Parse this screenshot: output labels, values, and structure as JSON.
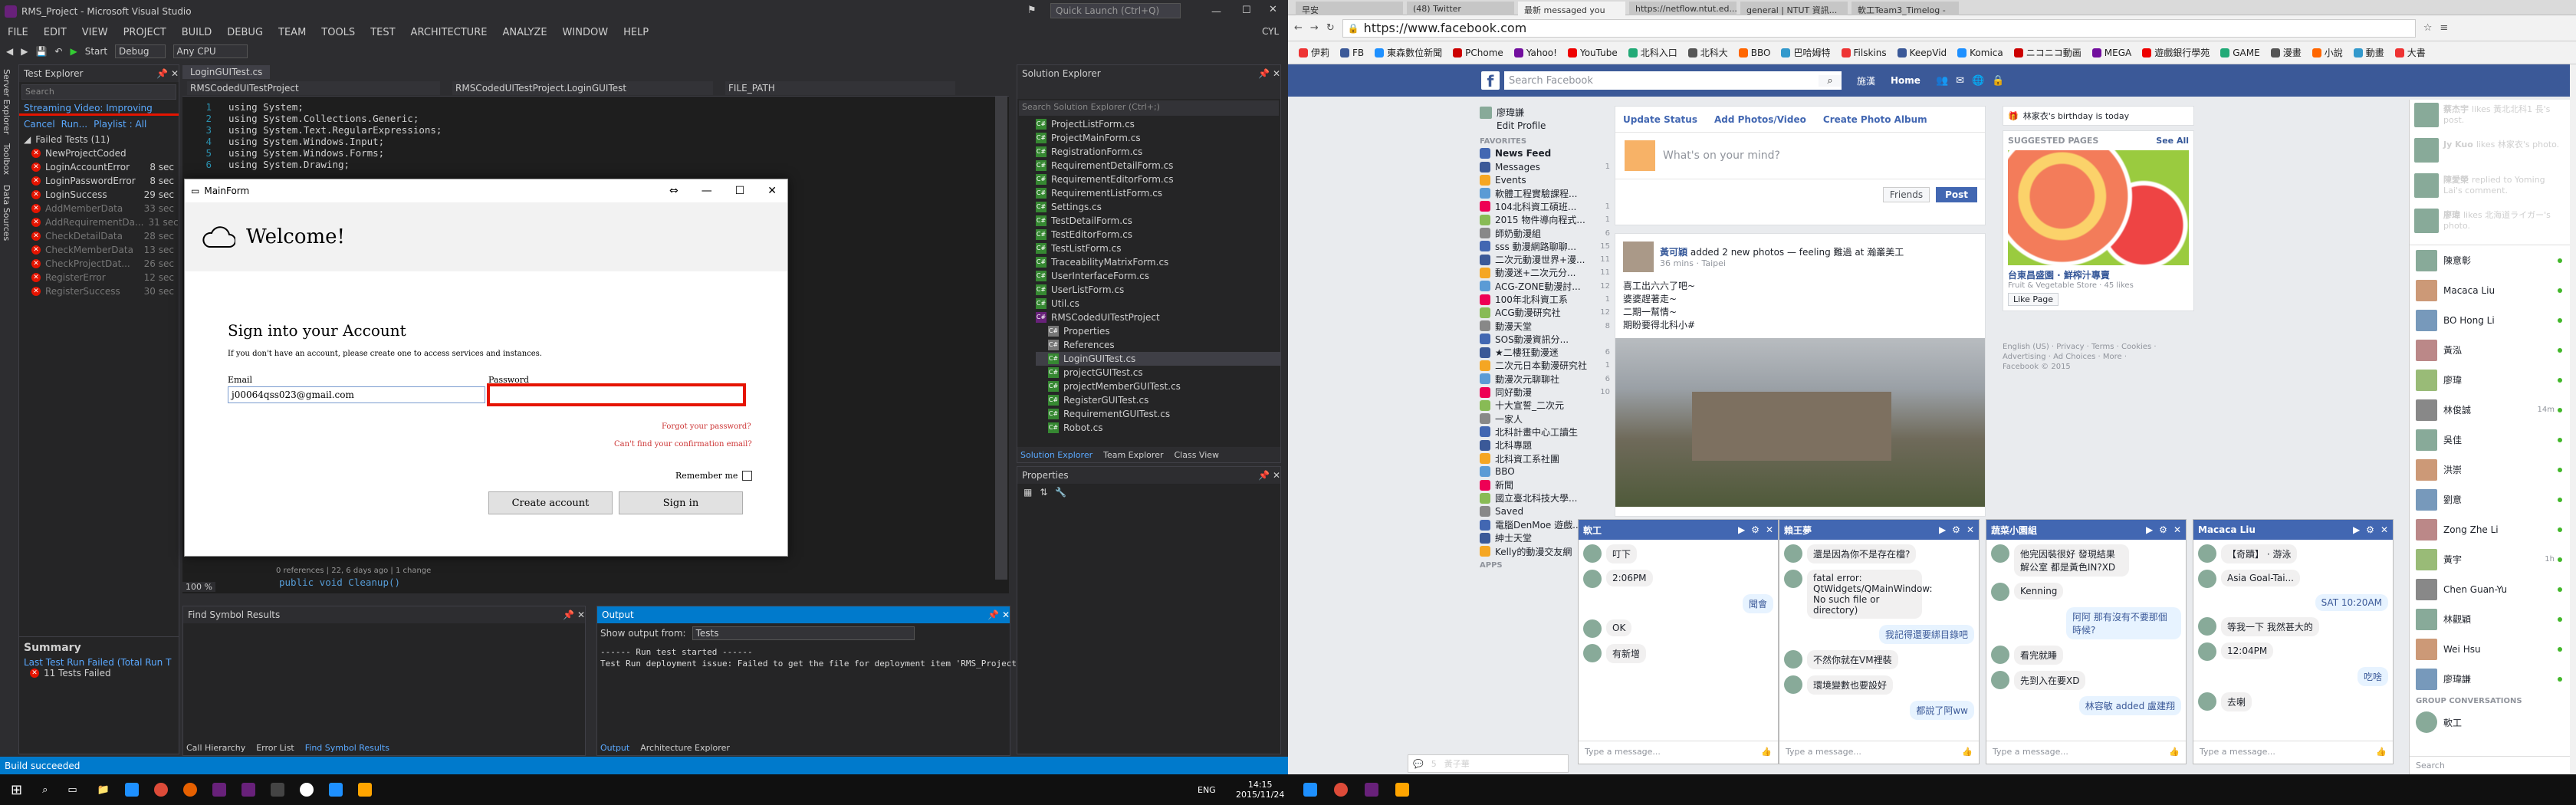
{
  "vs": {
    "window_title": "RMS_Project - Microsoft Visual Studio",
    "quick_launch_placeholder": "Quick Launch (Ctrl+Q)",
    "user": "CYL",
    "menu": [
      "FILE",
      "EDIT",
      "VIEW",
      "PROJECT",
      "BUILD",
      "DEBUG",
      "TEAM",
      "TOOLS",
      "TEST",
      "ARCHITECTURE",
      "ANALYZE",
      "WINDOW",
      "HELP"
    ],
    "toolbar": {
      "start": "Start",
      "config": "Debug",
      "platform": "Any CPU"
    },
    "test_explorer": {
      "title": "Test Explorer",
      "search_placeholder": "Search",
      "streaming": "Streaming Video: Improving",
      "actions": [
        "Cancel",
        "Run...",
        "Playlist : All"
      ],
      "failed_header": "Failed Tests (11)",
      "tests": [
        {
          "name": "NewProjectCoded",
          "time": ""
        },
        {
          "name": "LoginAccountError",
          "time": "8 sec"
        },
        {
          "name": "LoginPasswordError",
          "time": "8 sec"
        },
        {
          "name": "LoginSuccess",
          "time": "29 sec"
        },
        {
          "name": "AddMemberData",
          "time": "33 sec"
        },
        {
          "name": "AddRequirementDa...",
          "time": "31 sec"
        },
        {
          "name": "CheckDetailData",
          "time": "28 sec"
        },
        {
          "name": "CheckMemberData",
          "time": "13 sec"
        },
        {
          "name": "CheckProjectDat...",
          "time": "26 sec"
        },
        {
          "name": "RegisterError",
          "time": "12 sec"
        },
        {
          "name": "RegisterSuccess",
          "time": "30 sec"
        }
      ],
      "summary_title": "Summary",
      "summary_last": "Last Test Run Failed (Total Run T",
      "summary_failed": "11 Tests Failed"
    },
    "side_tabs": [
      "Server Explorer",
      "Toolbox",
      "Data Sources"
    ],
    "editor": {
      "tab": "LoginGUITest.cs",
      "nav_left": "RMSCodedUITestProject",
      "nav_mid": "RMSCodedUITestProject.LoginGUITest",
      "nav_right": "FILE_PATH",
      "lines": [
        "using System;",
        "using System.Collections.Generic;",
        "using System.Text.RegularExpressions;",
        "using System.Windows.Input;",
        "using System.Windows.Forms;",
        "using System.Drawing;"
      ],
      "bottom_hint": "0 references | 22, 6 days ago | 1 change",
      "bottom_code": "public void Cleanup()",
      "zoom": "100 %"
    },
    "find_symbol": {
      "title": "Find Symbol Results",
      "tabs": [
        "Call Hierarchy",
        "Error List",
        "Find Symbol Results"
      ]
    },
    "output": {
      "title": "Output",
      "show_from_label": "Show output from:",
      "show_from_value": "Tests",
      "lines": [
        "------ Run test started ------",
        "Test Run deployment issue: Failed to get the file for deployment item 'RMS_Project.ex"
      ],
      "tabs": [
        "Output",
        "Architecture Explorer"
      ]
    },
    "solution_explorer": {
      "title": "Solution Explorer",
      "search_placeholder": "Search Solution Explorer (Ctrl+;)",
      "items": [
        "ProjectListForm.cs",
        "ProjectMainForm.cs",
        "RegistrationForm.cs",
        "RequirementDetailForm.cs",
        "RequirementEditorForm.cs",
        "RequirementListForm.cs",
        "Settings.cs",
        "TestDetailForm.cs",
        "TestEditorForm.cs",
        "TestListForm.cs",
        "TraceabilityMatrixForm.cs",
        "UserInterfaceForm.cs",
        "UserListForm.cs",
        "Util.cs",
        "RMSCodedUITestProject",
        "Properties",
        "References",
        "LoginGUITest.cs",
        "projectGUITest.cs",
        "projectMemberGUITest.cs",
        "RegisterGUITest.cs",
        "RequirementGUITest.cs",
        "Robot.cs"
      ],
      "tabs": [
        "Solution Explorer",
        "Team Explorer",
        "Class View"
      ]
    },
    "properties": {
      "title": "Properties"
    },
    "status": "Build succeeded"
  },
  "mainform": {
    "title": "MainForm",
    "welcome": "Welcome!",
    "heading": "Sign into your Account",
    "subtext": "If you don't have an account, please create one to access services and instances.",
    "email_label": "Email",
    "email_value": "j00064qss023@gmail.com",
    "password_label": "Password",
    "forgot": "Forgot your password?",
    "cant_find": "Can't find your confirmation email?",
    "remember": "Remember me",
    "create_btn": "Create account",
    "signin_btn": "Sign in"
  },
  "browser": {
    "tabs": [
      "早安",
      "(48) Twitter",
      "最新 messaged you",
      "https://netflow.ntut.ed...",
      "general | NTUT 資訊...",
      "軟工Team3_Timelog -"
    ],
    "url": "https://www.facebook.com",
    "bookmarks": [
      "伊莉",
      "FB",
      "東森數位新聞",
      "PChome",
      "Yahoo!",
      "YouTube",
      "北科入口",
      "北科大",
      "BBO",
      "巴哈姆特",
      "Filskins",
      "KeepVid",
      "Komica",
      "ニコニコ動画",
      "MEGA",
      "遊戲銀行學苑",
      "GAME",
      "漫畫",
      "小說",
      "動畫",
      "大書"
    ],
    "fb": {
      "search_placeholder": "Search Facebook",
      "user": "施漢",
      "home": "Home",
      "left_top": [
        "廖瑋謙",
        "Edit Profile"
      ],
      "favorites_label": "FAVORITES",
      "left_items": [
        {
          "label": "News Feed",
          "count": ""
        },
        {
          "label": "Messages",
          "count": "1"
        },
        {
          "label": "Events",
          "count": ""
        },
        {
          "label": "軟體工程實驗課程...",
          "count": ""
        },
        {
          "label": "104北科資工碩班...",
          "count": "1"
        },
        {
          "label": "2015 物件導向程式...",
          "count": "1"
        },
        {
          "label": "師奶動漫組",
          "count": "6"
        },
        {
          "label": "sss 動漫網路聊聊...",
          "count": "15"
        },
        {
          "label": "二次元動漫世界+漫...",
          "count": "11"
        },
        {
          "label": "動漫迷+二次元分...",
          "count": "11"
        },
        {
          "label": "ACG-ZONE動漫討...",
          "count": "12"
        },
        {
          "label": "100年北科資工系",
          "count": "1"
        },
        {
          "label": "ACG動漫研究社",
          "count": "12"
        },
        {
          "label": "動漫天堂",
          "count": "8"
        },
        {
          "label": "SOS動漫資訊分...",
          "count": ""
        },
        {
          "label": "★二樓狂動漫迷",
          ".count": "",
          "count": "6"
        },
        {
          "label": "二次元日本動漫研究社",
          "count": "1"
        },
        {
          "label": "動漫次元聊聊社",
          "count": "6"
        },
        {
          "label": "同好動漫",
          "count": "10"
        },
        {
          "label": "十大宣誓_二次元",
          "count": ""
        },
        {
          "label": "一家人",
          "count": ""
        },
        {
          "label": "北科計畫中心工讀生",
          "count": ""
        },
        {
          "label": "北科專題",
          "count": ""
        },
        {
          "label": "北科資工系社團",
          "count": ""
        },
        {
          "label": "BBO",
          "count": ""
        },
        {
          "label": "新聞",
          "count": ""
        },
        {
          "label": "國立臺北科技大學...",
          "count": ""
        },
        {
          "label": "Saved",
          "count": ""
        },
        {
          "label": "電腦DenMoe 遊戲...",
          "count": ""
        },
        {
          "label": "紳士天堂",
          "count": ""
        },
        {
          "label": "Kelly的動漫交友網",
          "count": ""
        }
      ],
      "apps_label": "APPS",
      "composer": {
        "update": "Update Status",
        "photo": "Add Photos/Video",
        "album": "Create Photo Album",
        "placeholder": "What's on your mind?",
        "audience": "Friends",
        "post": "Post"
      },
      "post": {
        "author": "黃可穎",
        "action": "added 2 new photos — feeling 難過 at 瀚叢美工",
        "meta": "36 mins · Taipei",
        "text1": "喜工出六六了吧~",
        "text2": "婆婆趕著走~",
        "text3": "二期一幫情~",
        "text4": "期盼要得北科小#"
      },
      "right": {
        "birthday": "林家衣's birthday is today",
        "suggested": "SUGGESTED PAGES",
        "see_all": "See All",
        "page_name": "台東昌盛園 · 鮮榨汁專賣",
        "page_cat": "Fruit & Vegetable Store · 45 likes",
        "like_page": "Like Page",
        "footer": "English (US) · Privacy · Terms · Cookies · Advertising · Ad Choices · More ·",
        "copyright": "Facebook © 2015"
      },
      "ticker": [
        {
          "name": "蔡杰宇",
          "text": "likes 黃北北科1 長's post."
        },
        {
          "name": "Jy Kuo",
          "text": "likes 林家衣's photo."
        },
        {
          "name": "陳愛榮",
          "text": "replied to Yoming Lai's comment."
        },
        {
          "name": "廖瑋",
          "text": "likes 北海道ライガー's photo."
        }
      ],
      "contacts": [
        "陳意彰",
        "Macaca Liu",
        "BO Hong Li",
        "黃泓",
        "廖瑋",
        "林俊誠",
        "吳佳",
        "洪崇",
        "劉意",
        "Zong Zhe Li",
        "黃宇",
        "Chen Guan-Yu",
        "林觀穎",
        "Wei Hsu",
        "廖瑋謙"
      ],
      "contact_status": [
        "",
        "",
        "",
        "",
        "",
        "14m",
        "",
        "",
        "",
        "",
        "1h",
        "",
        "",
        "",
        ""
      ],
      "group_label": "GROUP CONVERSATIONS",
      "group_item": "軟工",
      "search_chat": "Search",
      "chats": [
        {
          "title": "軟工",
          "msgs": [
            "叮下",
            "2:06PM",
            "聞會",
            "OK",
            "有新增"
          ]
        },
        {
          "title": "賴王夢",
          "msgs": [
            "還是因為你不是存在檔?",
            "fatal error: QtWidgets/QMainWindow: No such file or directory)",
            "我記得還要綁目錄吧",
            "不然你就在VM裡裝",
            "環境變數也要設好",
            "都說了阿ww"
          ]
        },
        {
          "title": "蔬菜小園組",
          "msgs": [
            "他完因裝很好 發現結果解公室 都是黃色IN?XD",
            "Kenning",
            "阿阿 那有沒有不要那個時候?",
            "看完就睡",
            "先到入在要XD",
            "林容敏 added 盧建翔"
          ]
        },
        {
          "title": "Macaca Liu",
          "msgs": [
            "【奇蹟】 · 游泳",
            "Asia Goal-Tai...",
            "SAT 10:20AM",
            "等我一下 我然甚大的",
            "12:04PM",
            "吃啥",
            "去喇"
          ]
        }
      ],
      "chat_placeholder": "Type a message...",
      "notif_count": "5",
      "bottom_user": "黃子華"
    }
  },
  "taskbar": {
    "lang": "ENG",
    "time": "14:15",
    "date": "2015/11/24"
  }
}
